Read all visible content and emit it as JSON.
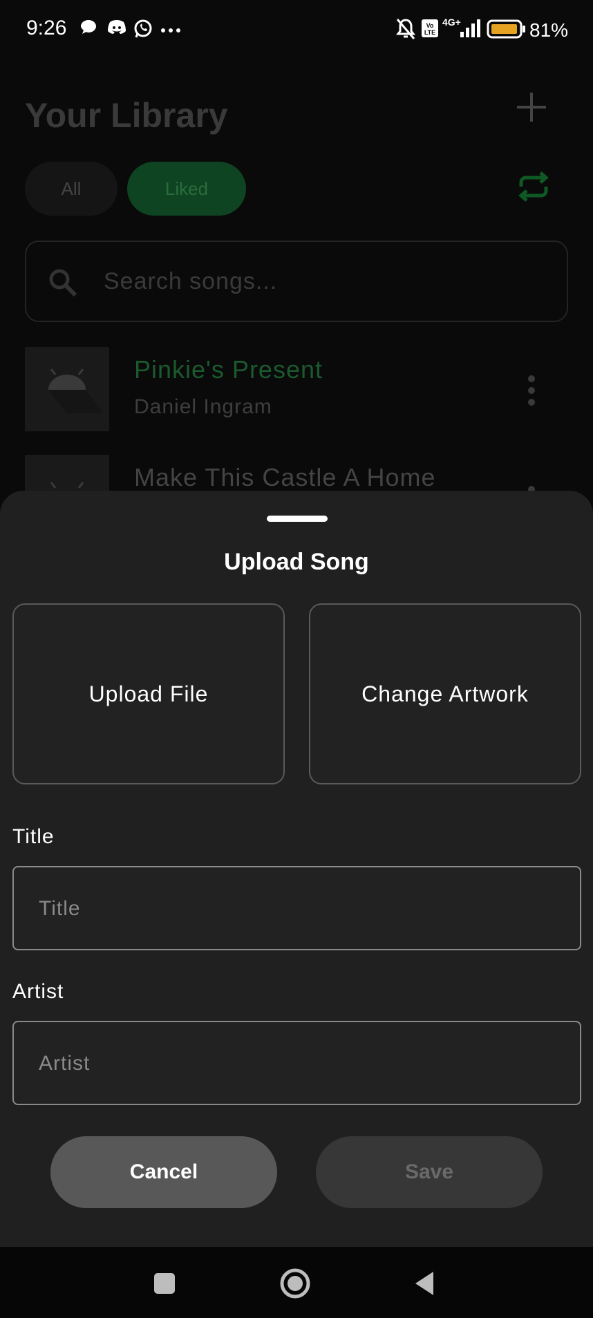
{
  "status_bar": {
    "time": "9:26",
    "battery": "81%",
    "network": "4G+"
  },
  "library": {
    "title": "Your Library",
    "chips": [
      {
        "label": "All"
      },
      {
        "label": "Liked"
      }
    ],
    "search": {
      "placeholder": "Search songs..."
    },
    "songs": [
      {
        "title": "Pinkie's Present",
        "artist": "Daniel Ingram"
      },
      {
        "title": "Make This Castle A Home",
        "artist": ""
      }
    ]
  },
  "sheet": {
    "title": "Upload Song",
    "upload_label": "Upload File",
    "artwork_label": "Change Artwork",
    "title_field": {
      "label": "Title",
      "placeholder": "Title",
      "value": ""
    },
    "artist_field": {
      "label": "Artist",
      "placeholder": "Artist",
      "value": ""
    },
    "cancel_label": "Cancel",
    "save_label": "Save"
  },
  "colors": {
    "accent": "#1db954",
    "sheet_bg": "#202020",
    "background": "#0a0a0a"
  }
}
